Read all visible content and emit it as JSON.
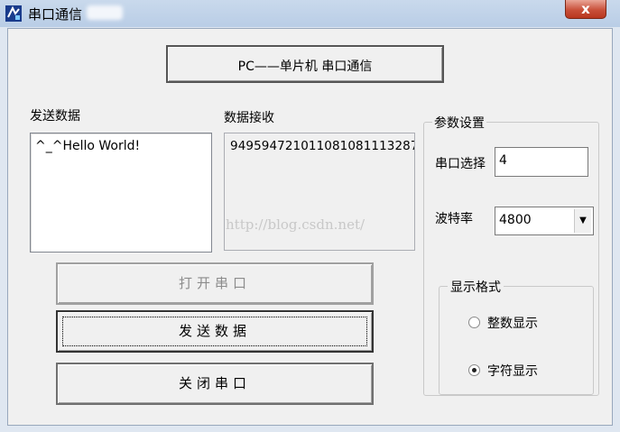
{
  "window": {
    "title": "串口通信",
    "close_glyph": "x"
  },
  "header_button": {
    "label": "PC——单片机  串口通信"
  },
  "send": {
    "label": "发送数据",
    "value": "^_^Hello World!"
  },
  "receive": {
    "label": "数据接收",
    "value": "949594721011081081113287"
  },
  "watermark": "http://blog.csdn.net/",
  "buttons": {
    "open_port": "打开串口",
    "send_data": "发送数据",
    "close_port": "关闭串口"
  },
  "params": {
    "group_title": "参数设置",
    "port_label": "串口选择",
    "port_value": "4",
    "baud_label": "波特率",
    "baud_value": "4800",
    "display_group_title": "显示格式",
    "display_options": [
      {
        "label": "整数显示",
        "selected": false
      },
      {
        "label": "字符显示",
        "selected": true
      }
    ]
  },
  "colors": {
    "window_frame": "#dfe7f1",
    "client_bg": "#f0f0f0",
    "close_button": "#c9503a"
  }
}
